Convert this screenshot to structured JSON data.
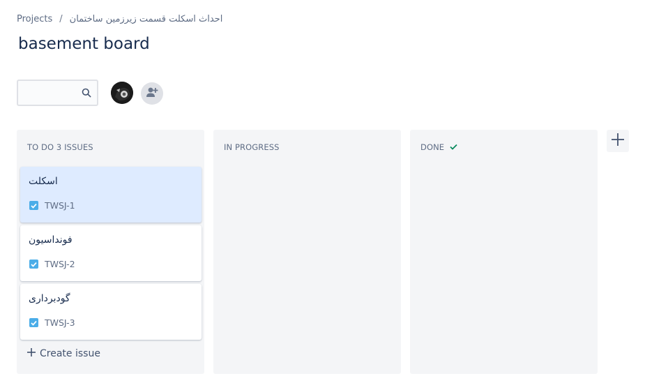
{
  "breadcrumb": {
    "projects": "Projects",
    "separator": "/",
    "project_name": "احداث اسکلت قسمت زیرزمین ساختمان"
  },
  "board": {
    "title": "basement board"
  },
  "search": {
    "value": "",
    "icon": "search-icon"
  },
  "members": {
    "avatar_icon": "user-avatar",
    "add_icon": "add-person-icon"
  },
  "columns": [
    {
      "title": "TO DO 3 ISSUES",
      "cards": [
        {
          "summary": "اسکلت",
          "key": "TWSJ-1",
          "type_icon": "task-checkbox-icon",
          "selected": true
        },
        {
          "summary": "فونداسیون",
          "key": "TWSJ-2",
          "type_icon": "task-checkbox-icon"
        },
        {
          "summary": "گودبرداری",
          "key": "TWSJ-3",
          "type_icon": "task-checkbox-icon"
        }
      ],
      "create_label": "Create issue"
    },
    {
      "title": "IN PROGRESS",
      "cards": []
    },
    {
      "title": "DONE",
      "done_icon": "check-icon",
      "cards": []
    }
  ],
  "colors": {
    "accent": "#0052cc",
    "column_bg": "#f4f5f7",
    "selected_card": "#deebff",
    "task_icon": "#4bade8",
    "done_check": "#00875a"
  }
}
